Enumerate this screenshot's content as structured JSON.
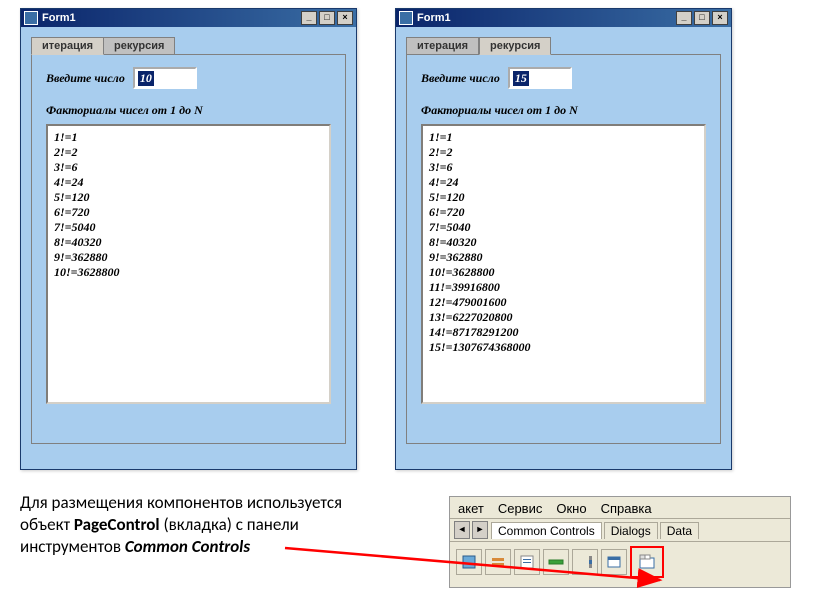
{
  "windows": {
    "left": {
      "title": "Form1",
      "tab_active": "итерация",
      "tab_inactive": "рекурсия",
      "prompt": "Введите число",
      "value": "10",
      "heading": "Факториалы чисел от 1 до N",
      "results": "1!=1\n2!=2\n3!=6\n4!=24\n5!=120\n6!=720\n7!=5040\n8!=40320\n9!=362880\n10!=3628800"
    },
    "right": {
      "title": "Form1",
      "tab_active": "итерация",
      "tab_inactive": "рекурсия",
      "prompt": "Введите число",
      "value": "15",
      "heading": "Факториалы чисел от 1 до N",
      "results": "1!=1\n2!=2\n3!=6\n4!=24\n5!=120\n6!=720\n7!=5040\n8!=40320\n9!=362880\n10!=3628800\n11!=39916800\n12!=479001600\n13!=6227020800\n14!=87178291200\n15!=1307674368000"
    }
  },
  "caption": {
    "line1": "Для размещения компонентов используется",
    "line2a": "объект  ",
    "page_control": "PageControl",
    "line2b": " (вкладка) с панели",
    "line3a": "инструментов ",
    "common_controls": "Common Controls"
  },
  "ide": {
    "menu": [
      "акет",
      "Сервис",
      "Окно",
      "Справка"
    ],
    "tabs_left_arrow": "◄",
    "tabs_right_arrow": "►",
    "tabs": [
      "Common Controls",
      "Dialogs",
      "Data"
    ]
  },
  "winbtns": {
    "min": "_",
    "max": "□",
    "close": "×"
  }
}
